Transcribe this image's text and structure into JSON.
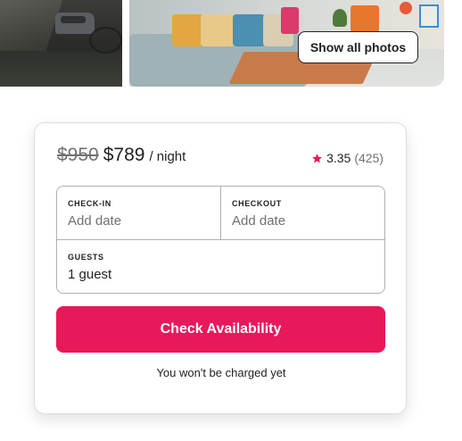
{
  "gallery": {
    "show_all_label": "Show all photos",
    "photos": [
      "canal-street-photo",
      "living-room-photo"
    ]
  },
  "booking": {
    "original_price": "$950",
    "price": "$789",
    "price_unit": "/ night",
    "rating": {
      "icon": "star-icon",
      "score": "3.35",
      "count": "(425)",
      "color": "#e8195a"
    },
    "check_in": {
      "label": "CHECK-IN",
      "placeholder": "Add date"
    },
    "checkout": {
      "label": "CHECKOUT",
      "placeholder": "Add date"
    },
    "guests": {
      "label": "GUESTS",
      "value": "1 guest"
    },
    "cta_label": "Check Availability",
    "cta_color": "#e8195a",
    "note": "You won't be charged yet"
  }
}
